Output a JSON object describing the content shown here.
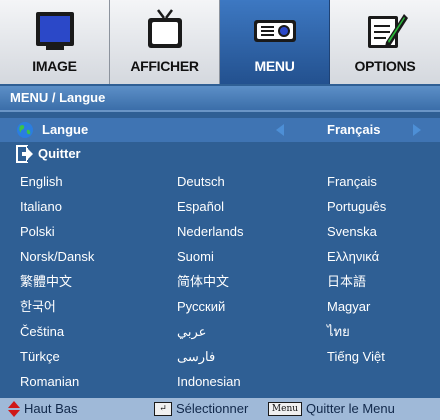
{
  "tabs": [
    {
      "label": "IMAGE",
      "icon": "monitor-icon",
      "active": false
    },
    {
      "label": "AFFICHER",
      "icon": "tv-icon",
      "active": false
    },
    {
      "label": "MENU",
      "icon": "projector-icon",
      "active": true
    },
    {
      "label": "OPTIONS",
      "icon": "notepad-icon",
      "active": false
    }
  ],
  "title": "MENU / Langue",
  "rows": {
    "language": {
      "label": "Langue",
      "value": "Français",
      "icon": "globe-icon"
    },
    "quit": {
      "label": "Quitter",
      "icon": "exit-icon"
    }
  },
  "languages": [
    [
      "English",
      "Deutsch",
      "Français"
    ],
    [
      "Italiano",
      "Español",
      "Português"
    ],
    [
      "Polski",
      "Nederlands",
      "Svenska"
    ],
    [
      "Norsk/Dansk",
      "Suomi",
      "Ελληνικά"
    ],
    [
      "繁體中文",
      "简体中文",
      "日本語"
    ],
    [
      "한국어",
      "Русский",
      "Magyar"
    ],
    [
      "Čeština",
      "عربي",
      "ไทย"
    ],
    [
      "Türkçe",
      "فارسی",
      "Tiếng Việt"
    ],
    [
      "Romanian",
      "Indonesian",
      ""
    ]
  ],
  "bottom": {
    "nav": "Haut Bas",
    "select": "Sélectionner",
    "menu_key": "Menu",
    "quit": "Quitter le Menu"
  },
  "colors": {
    "background": "#2f5f94",
    "active_tab": "#2d63a8",
    "arrow": "#4d8fd6",
    "bottom_bar": "#9fb9d8"
  }
}
